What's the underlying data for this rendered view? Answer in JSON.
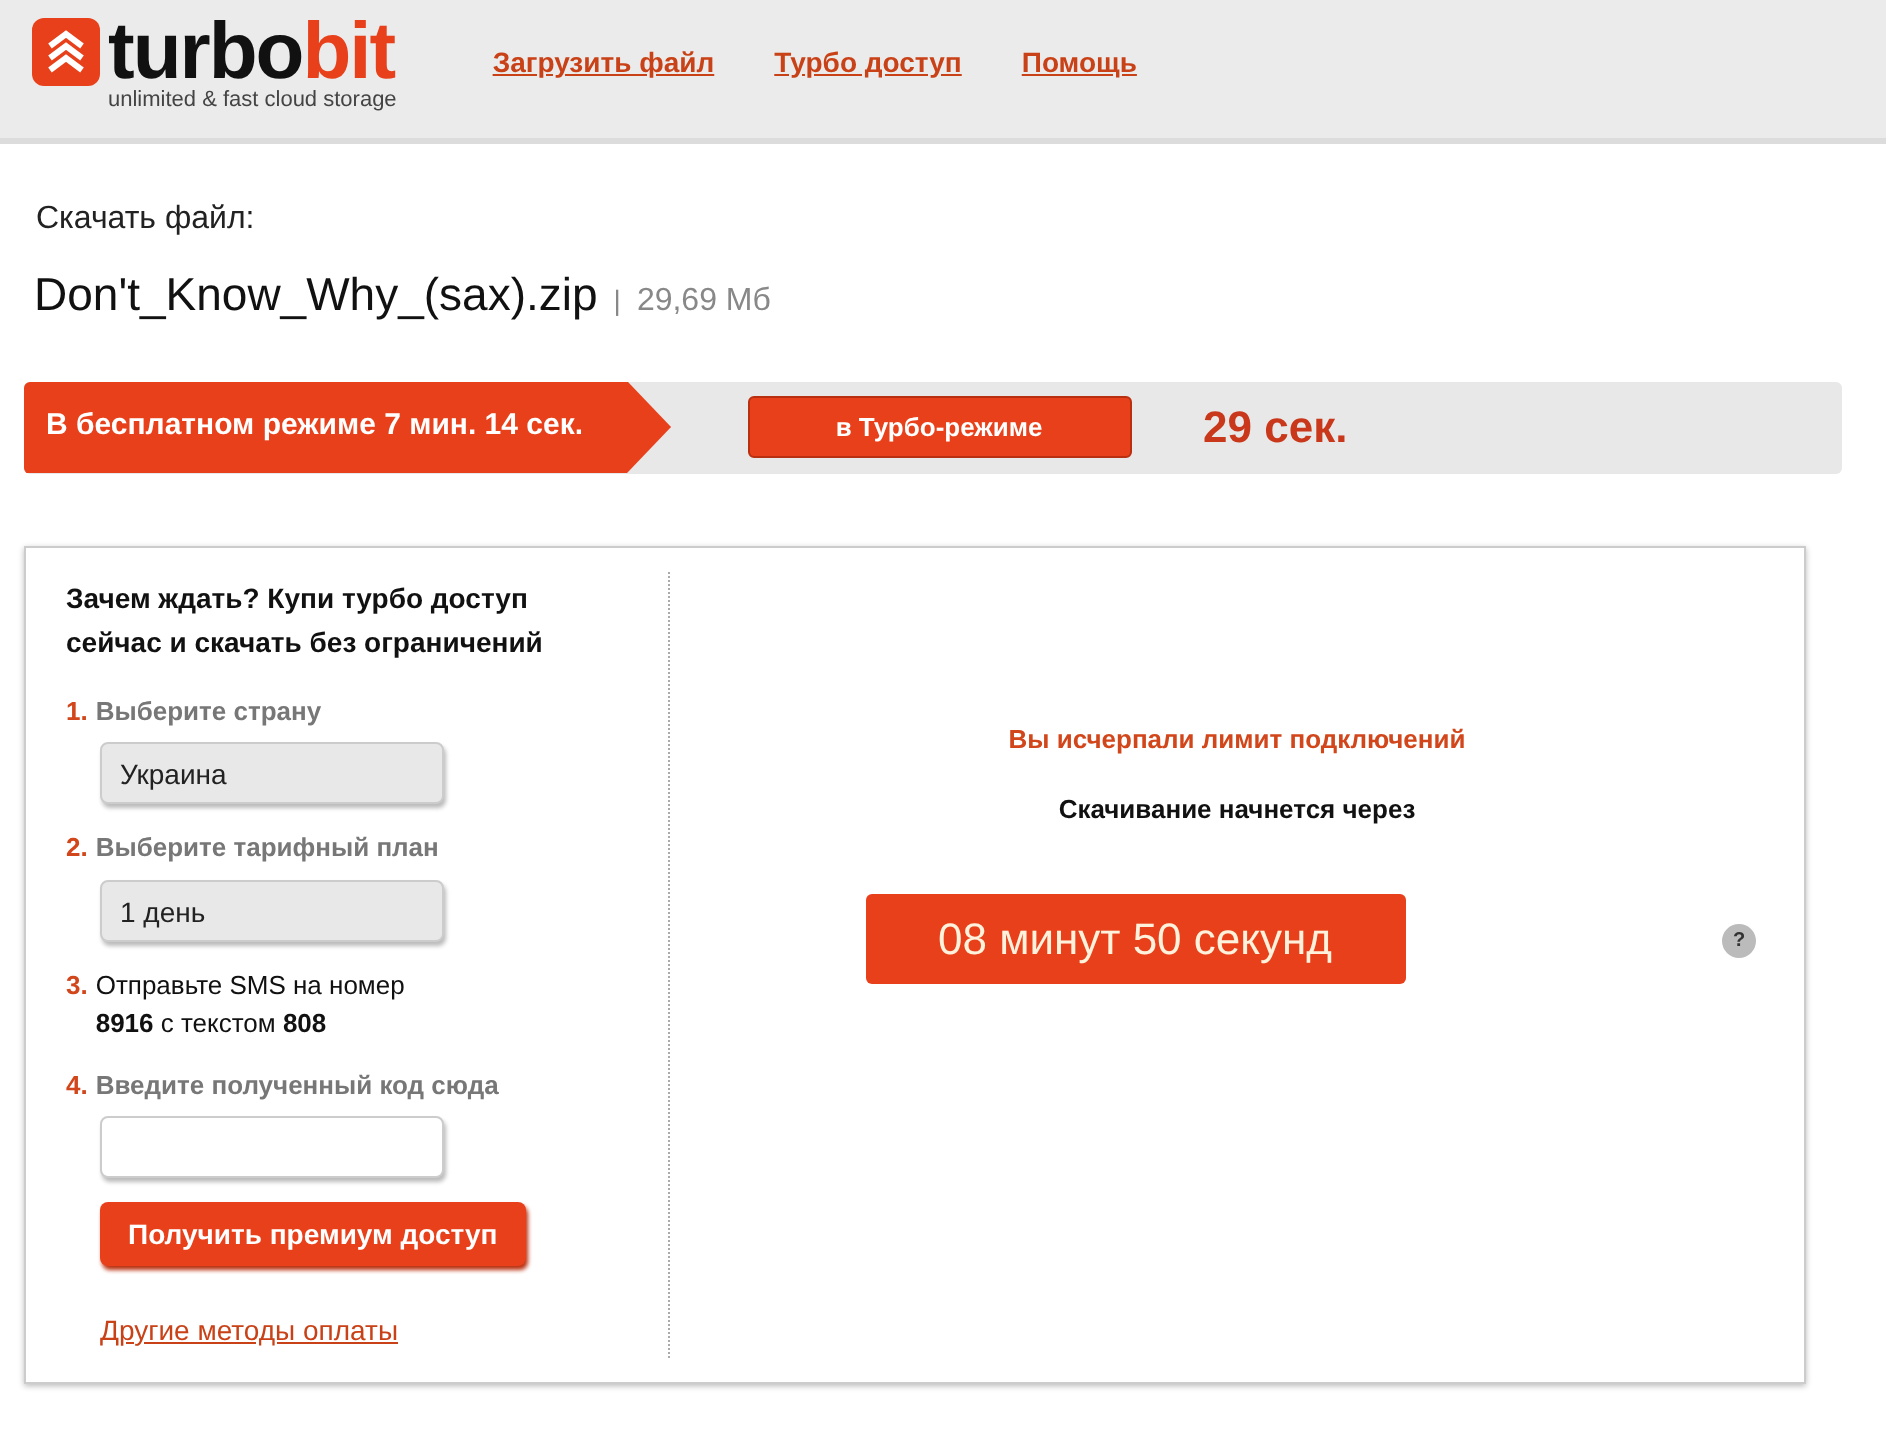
{
  "header": {
    "logo": {
      "word1": "turbo",
      "word2": "bit",
      "tagline": "unlimited & fast cloud storage"
    },
    "nav": [
      "Загрузить файл",
      "Турбо доступ",
      "Помощь"
    ]
  },
  "download": {
    "label": "Скачать файл:",
    "filename": "Don't_Know_Why_(sax).zip",
    "separator": "|",
    "size": "29,69 Мб"
  },
  "speed_bar": {
    "free_mode": "В бесплатном режиме 7 мин. 14 сек.",
    "turbo_button": "в Турбо-режиме",
    "turbo_time": "29 сек."
  },
  "premium": {
    "title": "Зачем ждать? Купи турбо доступ сейчас и скачать без ограничений",
    "steps": [
      {
        "number": "1.",
        "kind": "select",
        "label": "Выберите страну",
        "value": "Украина"
      },
      {
        "number": "2.",
        "kind": "select",
        "label": "Выберите тарифный план",
        "value": "1 день"
      },
      {
        "number": "3.",
        "kind": "text",
        "label": "Отправьте SMS на номер\n**8916** с текстом **808**"
      },
      {
        "number": "4.",
        "kind": "input",
        "label": "Введите полученный код сюда"
      }
    ],
    "button": "Получить премиум доступ",
    "other_link": "Другие методы оплаты"
  },
  "wait": {
    "message": "Вы исчерпали лимит подключений",
    "subtitle": "Скачивание начнется через",
    "countdown": "08 минут 50 секунд",
    "help": "?"
  }
}
